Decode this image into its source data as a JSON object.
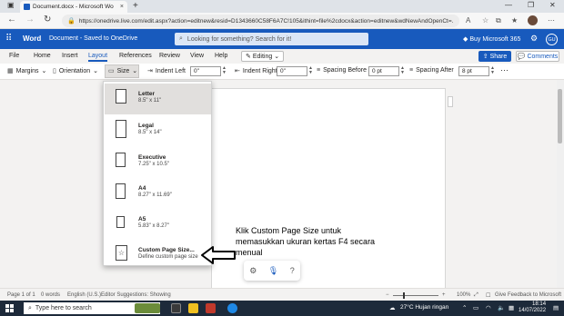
{
  "browser": {
    "tab_title": "Document.docx - Microsoft Wo",
    "tab_close": "×",
    "new_tab": "+",
    "url": "https://onedrive.live.com/edit.aspx?action=editnew&resid=D1343660C58F6A7C!105&ithint=file%2cdocx&action=editnew&wdNewAndOpenCt=...",
    "window_controls": [
      "—",
      "❐",
      "✕"
    ]
  },
  "word": {
    "app_name": "Word",
    "doc_name": "Document - Saved to OneDrive",
    "search_placeholder": "Looking for something? Search for it!",
    "buy_label": "Buy Microsoft 365",
    "user_initials": "GU"
  },
  "ribbon": {
    "tabs": [
      "File",
      "Home",
      "Insert",
      "Layout",
      "References",
      "Review",
      "View",
      "Help"
    ],
    "active_tab": "Layout",
    "editing_label": "Editing",
    "share_label": "Share",
    "comments_label": "Comments"
  },
  "toolbar": {
    "margins": "Margins",
    "orientation": "Orientation",
    "size": "Size",
    "indent_left_label": "Indent Left",
    "indent_left_value": "0\"",
    "indent_right_label": "Indent Right",
    "indent_right_value": "0\"",
    "spacing_before_label": "Spacing Before",
    "spacing_before_value": "0 pt",
    "spacing_after_label": "Spacing After",
    "spacing_after_value": "8 pt",
    "more": "···"
  },
  "size_menu": {
    "items": [
      {
        "name": "Letter",
        "dims": "8.5\" x 11\""
      },
      {
        "name": "Legal",
        "dims": "8.5\" x 14\""
      },
      {
        "name": "Executive",
        "dims": "7.25\" x 10.5\""
      },
      {
        "name": "A4",
        "dims": "8.27\" x 11.69\""
      },
      {
        "name": "A5",
        "dims": "5.83\" x 8.27\""
      },
      {
        "name": "Custom Page Size...",
        "dims": "Define custom page size"
      }
    ],
    "selected_index": 0
  },
  "annotation": {
    "text": "Klik Custom Page Size untuk memasukkan ukuran kertas F4 secara menual"
  },
  "status": {
    "page": "Page 1 of 1",
    "words": "0 words",
    "language": "English (U.S.)",
    "editor": "Editor Suggestions: Showing",
    "zoom": "100%",
    "feedback": "Give Feedback to Microsoft"
  },
  "taskbar": {
    "search_placeholder": "Type here to search",
    "weather": "27°C Hujan ringan",
    "time": "18:14",
    "date": "14/07/2022"
  },
  "colors": {
    "word_blue": "#185abd",
    "taskbar": "#1d2a3a"
  }
}
